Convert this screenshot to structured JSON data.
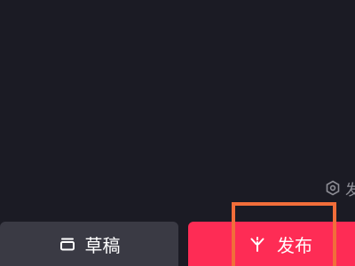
{
  "hint": {
    "text": "发",
    "icon": "shield-settings-icon"
  },
  "bottom_bar": {
    "draft_label": "草稿",
    "draft_icon": "draft-box-icon",
    "publish_label": "发布",
    "publish_icon": "sparkle-icon"
  },
  "colors": {
    "background": "#1b1b24",
    "draft_button": "#3a3a44",
    "publish_button": "#fe2c55",
    "highlight": "#f26e3a"
  }
}
